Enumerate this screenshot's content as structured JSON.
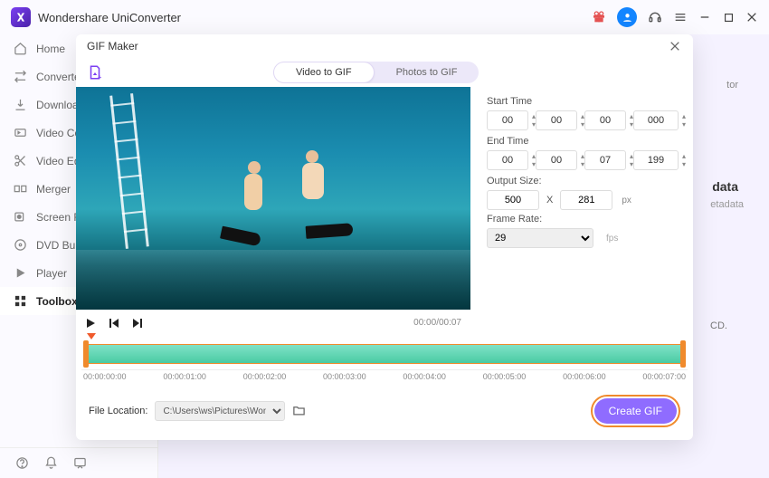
{
  "app": {
    "title": "Wondershare UniConverter"
  },
  "sidebar": {
    "items": [
      {
        "label": "Home"
      },
      {
        "label": "Converter"
      },
      {
        "label": "Downloader"
      },
      {
        "label": "Video Compressor"
      },
      {
        "label": "Video Editor"
      },
      {
        "label": "Merger"
      },
      {
        "label": "Screen Recorder"
      },
      {
        "label": "DVD Burner"
      },
      {
        "label": "Player"
      },
      {
        "label": "Toolbox"
      }
    ]
  },
  "rightPanel": {
    "badge": "tor",
    "metaTitle": "data",
    "metaSub": "etadata",
    "cd": "CD."
  },
  "modal": {
    "title": "GIF Maker",
    "tabs": {
      "video": "Video to GIF",
      "photos": "Photos to GIF"
    },
    "video": {
      "position": "00:00",
      "duration": "00:07",
      "separator": "/"
    },
    "start": {
      "label": "Start Time",
      "hh": "00",
      "mm": "00",
      "ss": "00",
      "ms": "000"
    },
    "end": {
      "label": "End Time",
      "hh": "00",
      "mm": "00",
      "ss": "07",
      "ms": "199"
    },
    "outputSize": {
      "label": "Output Size:",
      "w": "500",
      "h": "281",
      "x": "X",
      "px": "px"
    },
    "frameRate": {
      "label": "Frame Rate:",
      "value": "29",
      "unit": "fps"
    },
    "timeline": {
      "ticks": [
        "00:00:00:00",
        "00:00:01:00",
        "00:00:02:00",
        "00:00:03:00",
        "00:00:04:00",
        "00:00:05:00",
        "00:00:06:00",
        "00:00:07:00"
      ]
    },
    "fileLocation": {
      "label": "File Location:",
      "value": "C:\\Users\\ws\\Pictures\\Wonders"
    },
    "createLabel": "Create GIF"
  }
}
